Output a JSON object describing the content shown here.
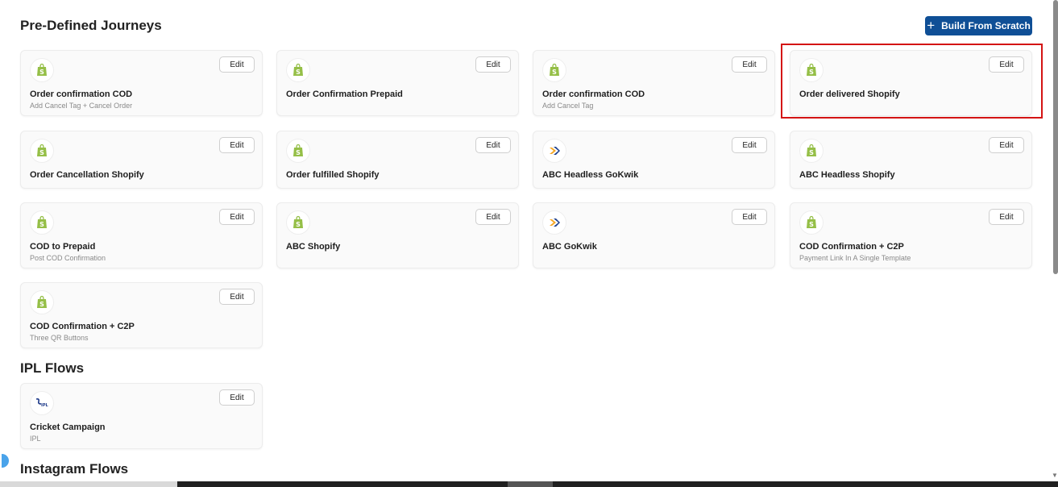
{
  "header": {
    "title": "Pre-Defined Journeys",
    "build_label": "Build From Scratch"
  },
  "edit_label": "Edit",
  "journeys": [
    {
      "title": "Order confirmation COD",
      "subtitle": "Add Cancel Tag + Cancel Order",
      "icon": "shopify"
    },
    {
      "title": "Order Confirmation Prepaid",
      "subtitle": "",
      "icon": "shopify"
    },
    {
      "title": "Order confirmation COD",
      "subtitle": "Add Cancel Tag",
      "icon": "shopify"
    },
    {
      "title": "Order delivered Shopify",
      "subtitle": "",
      "icon": "shopify"
    },
    {
      "title": "Order Cancellation Shopify",
      "subtitle": "",
      "icon": "shopify"
    },
    {
      "title": "Order fulfilled Shopify",
      "subtitle": "",
      "icon": "shopify"
    },
    {
      "title": "ABC Headless GoKwik",
      "subtitle": "",
      "icon": "gokwik"
    },
    {
      "title": "ABC Headless Shopify",
      "subtitle": "",
      "icon": "shopify"
    },
    {
      "title": "COD to Prepaid",
      "subtitle": "Post COD Confirmation",
      "icon": "shopify"
    },
    {
      "title": "ABC Shopify",
      "subtitle": "",
      "icon": "shopify"
    },
    {
      "title": "ABC GoKwik",
      "subtitle": "",
      "icon": "gokwik"
    },
    {
      "title": "COD Confirmation + C2P",
      "subtitle": "Payment Link In A Single Template",
      "icon": "shopify"
    },
    {
      "title": "COD Confirmation + C2P",
      "subtitle": "Three QR Buttons",
      "icon": "shopify"
    }
  ],
  "ipl": {
    "title": "IPL Flows",
    "cards": [
      {
        "title": "Cricket Campaign",
        "subtitle": "IPL",
        "icon": "ipl"
      }
    ]
  },
  "instagram": {
    "title": "Instagram Flows"
  },
  "colors": {
    "primary": "#0f4f96",
    "highlight": "#d41414",
    "shopify": "#95bf47"
  }
}
